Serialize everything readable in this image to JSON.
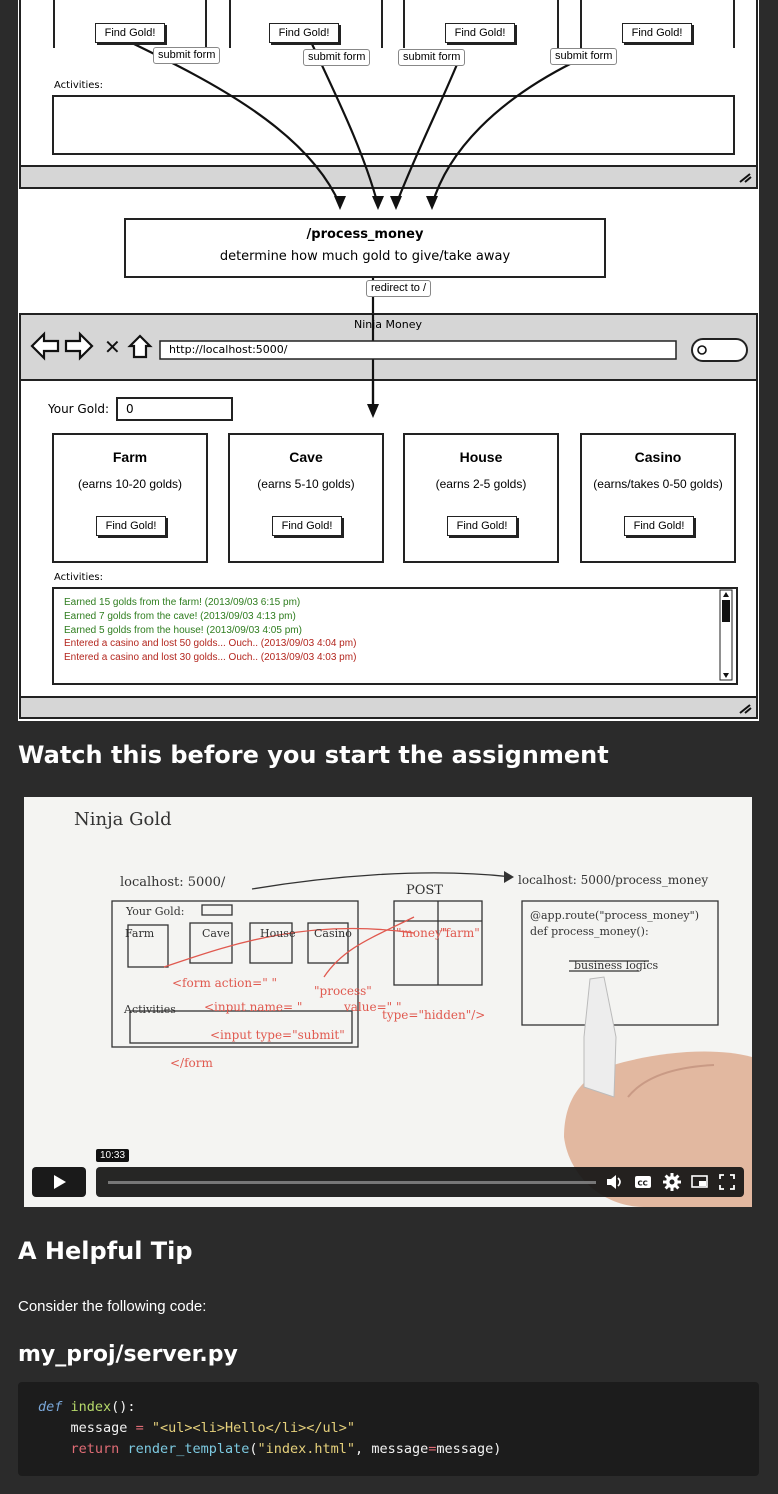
{
  "wireframe": {
    "top_buttons": [
      "Find Gold!",
      "Find Gold!",
      "Find Gold!",
      "Find Gold!"
    ],
    "submit_tags": [
      "submit form",
      "submit form",
      "submit form",
      "submit form"
    ],
    "activities_label_top": "Activities:",
    "process_box": {
      "route": "/process_money",
      "description": "determine how much gold to give/take away"
    },
    "redirect_tag": "redirect to /",
    "browser": {
      "title": "Ninja Money",
      "url": "http://localhost:5000/"
    },
    "your_gold_label": "Your Gold:",
    "your_gold_value": "0",
    "buildings": [
      {
        "name": "Farm",
        "subtitle": "(earns 10-20 golds)",
        "button": "Find Gold!"
      },
      {
        "name": "Cave",
        "subtitle": "(earns 5-10 golds)",
        "button": "Find Gold!"
      },
      {
        "name": "House",
        "subtitle": "(earns 2-5 golds)",
        "button": "Find Gold!"
      },
      {
        "name": "Casino",
        "subtitle": "(earns/takes 0-50 golds)",
        "button": "Find Gold!"
      }
    ],
    "activities_label": "Activities:",
    "log": [
      {
        "text": "Earned 15 golds from the farm! (2013/09/03 6:15 pm)",
        "color": "#2e7d1e"
      },
      {
        "text": "Earned 7 golds from the cave! (2013/09/03 4:13 pm)",
        "color": "#2e7d1e"
      },
      {
        "text": "Earned 5 golds from the house! (2013/09/03 4:05 pm)",
        "color": "#2e7d1e"
      },
      {
        "text": "Entered a casino and lost 50 golds... Ouch.. (2013/09/03 4:04 pm)",
        "color": "#b3261e"
      },
      {
        "text": "Entered a casino and lost 30 golds... Ouch.. (2013/09/03 4:03 pm)",
        "color": "#b3261e"
      }
    ]
  },
  "headings": {
    "watch": "Watch this before you start the assignment",
    "tip": "A Helpful Tip",
    "file": "my_proj/server.py"
  },
  "video": {
    "duration": "10:33",
    "whiteboard_title": "Ninja Gold",
    "whiteboard_url_left": "localhost: 5000/",
    "whiteboard_url_right": "localhost: 5000/process_money",
    "whiteboard_post": "POST",
    "progress": 0
  },
  "tip_text": "Consider the following code:",
  "code": {
    "line1_kw": "def",
    "line1_fn": "index",
    "line1_rest": "():",
    "line2_var": "message",
    "line2_op": "=",
    "line2_str": "\"<ul><li>Hello</li></ul>\"",
    "line3_kw": "return",
    "line3_fn": "render_template",
    "line3_str": "\"index.html\"",
    "line3_arg": "message",
    "line3_val": "message"
  }
}
